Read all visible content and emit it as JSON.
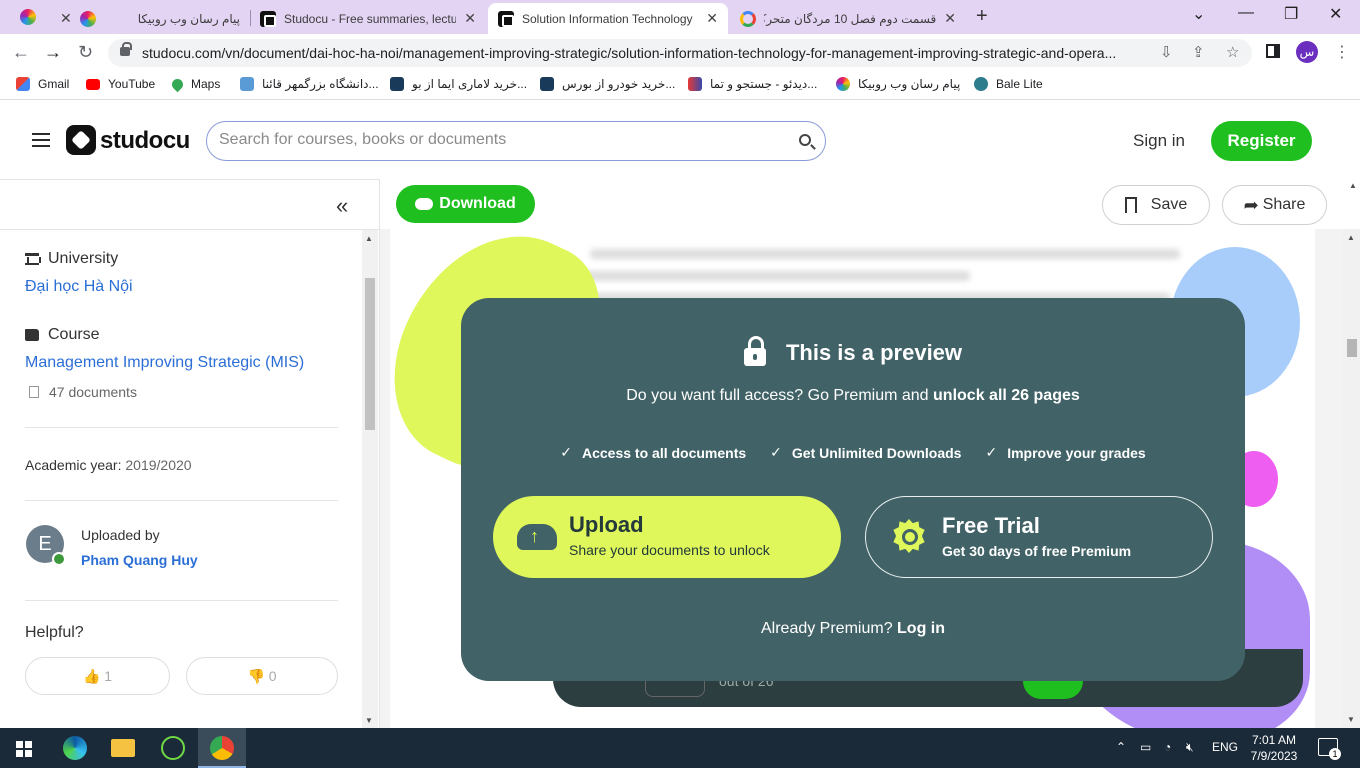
{
  "browser": {
    "tabs": [
      {
        "title": "پیام رسان وب روبیکا",
        "icon": "rubika-icon"
      },
      {
        "title": "Studocu - Free summaries, lectur",
        "icon": "studocu-icon"
      },
      {
        "title": "Solution Information Technology",
        "icon": "studocu-icon",
        "active": true
      },
      {
        "title": "قسمت دوم فصل 10 مردگان متحرک",
        "icon": "google-icon"
      }
    ],
    "url": "studocu.com/vn/document/dai-hoc-ha-noi/management-improving-strategic/solution-information-technology-for-management-improving-strategic-and-opera...",
    "profile_initial": "س",
    "bookmarks": [
      {
        "label": "Gmail"
      },
      {
        "label": "YouTube"
      },
      {
        "label": "Maps"
      },
      {
        "label": "دانشگاه بزرگمهر قائنا..."
      },
      {
        "label": "خرید لاماری ایما از بو..."
      },
      {
        "label": "خرید خودرو از بورس..."
      },
      {
        "label": "دیدئو - جستجو و تما..."
      },
      {
        "label": "پیام رسان وب روبیکا"
      },
      {
        "label": "Bale Lite"
      }
    ]
  },
  "header": {
    "logo_text": "studocu",
    "search_placeholder": "Search for courses, books or documents",
    "sign_in": "Sign in",
    "register": "Register"
  },
  "sidebar": {
    "university_label": "University",
    "university_name": "Đại học Hà Nội",
    "course_label": "Course",
    "course_name": "Management Improving Strategic (MIS)",
    "course_docs": "47 documents",
    "academic_year_label": "Academic year:",
    "academic_year": "2019/2020",
    "uploaded_by_label": "Uploaded by",
    "uploader_name": "Pham Quang Huy",
    "uploader_initial": "E",
    "helpful_label": "Helpful?",
    "helpful_yes": "1",
    "helpful_no": "0"
  },
  "toolbar": {
    "download": "Download",
    "save": "Save",
    "share": "Share"
  },
  "viewer": {
    "pager_text": "out of 26"
  },
  "modal": {
    "title": "This is a preview",
    "subtitle_prefix": "Do you want full access? Go Premium and ",
    "subtitle_bold": "unlock all 26 pages",
    "features": [
      "Access to all documents",
      "Get Unlimited Downloads",
      "Improve your grades"
    ],
    "upload_title": "Upload",
    "upload_sub": "Share your documents to unlock",
    "trial_title": "Free Trial",
    "trial_sub": "Get 30 days of free Premium",
    "footer_prefix": "Already Premium? ",
    "footer_link": "Log in"
  },
  "taskbar": {
    "language": "ENG",
    "time": "7:01 AM",
    "date": "7/9/2023",
    "notification_count": "1"
  },
  "colors": {
    "brand_green": "#1fbf1f",
    "modal_bg": "#416266",
    "upload_card": "#dff75a",
    "link_blue": "#2b6fd6"
  }
}
